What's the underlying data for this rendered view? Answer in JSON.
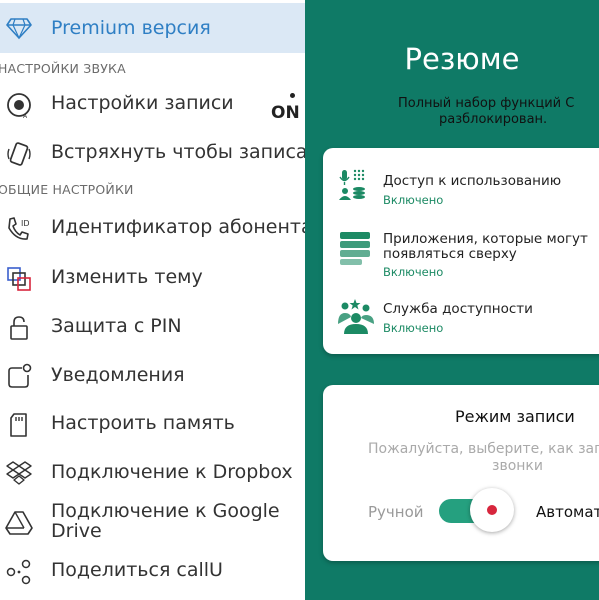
{
  "sidebar": {
    "premium_label": "Premium версия",
    "section_sound": "НАСТРОЙКИ ЗВУКА",
    "section_general": "ОБЩИЕ НАСТРОЙКИ",
    "on_label": "ON",
    "items": [
      {
        "label": "Настройки записи",
        "icon": "record-settings-icon"
      },
      {
        "label": "Встряхнуть чтобы записать",
        "icon": "shake-phone-icon"
      },
      {
        "label": "Идентификатор абонента",
        "icon": "caller-id-icon"
      },
      {
        "label": "Изменить тему",
        "icon": "theme-icon"
      },
      {
        "label": "Защита с PIN",
        "icon": "lock-icon"
      },
      {
        "label": "Уведомления",
        "icon": "notification-icon"
      },
      {
        "label": "Настроить память",
        "icon": "sd-card-icon"
      },
      {
        "label": "Подключение к Dropbox",
        "icon": "dropbox-icon"
      },
      {
        "label_line1": "Подключение к Google",
        "label_line2": "Drive",
        "icon": "google-drive-icon"
      },
      {
        "label": "Поделиться callU",
        "icon": "share-icon"
      }
    ]
  },
  "summary": {
    "title": "Резюме",
    "subtitle_line1": "Полный набор функций С",
    "subtitle_line2": "разблокирован.",
    "permissions": [
      {
        "title_line1": "Доступ к использованию",
        "title_line2": "",
        "status": "Включено",
        "icon": "usage-access-icon"
      },
      {
        "title_line1": "Приложения, которые могут",
        "title_line2": "появляться сверху",
        "status": "Включено",
        "icon": "overlay-apps-icon"
      },
      {
        "title_line1": "Служба доступности",
        "title_line2": "",
        "status": "Включено",
        "icon": "accessibility-service-icon"
      }
    ]
  },
  "record_mode": {
    "title": "Режим записи",
    "desc_line1": "Пожалуйста, выберите, как запи",
    "desc_line2": "звонки",
    "manual_label": "Ручной",
    "auto_label": "Автомат"
  },
  "colors": {
    "accent_green": "#0f7a66",
    "status_green": "#1c8a64",
    "toggle_green": "#25a07f",
    "record_red": "#d7263d",
    "premium_blue": "#2f7fc4",
    "premium_bg": "#dbe8f5"
  }
}
